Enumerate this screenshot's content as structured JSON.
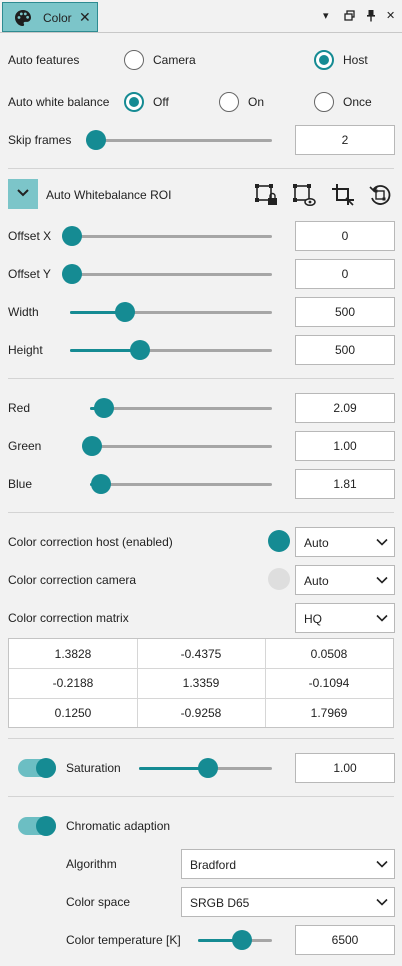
{
  "tab": {
    "title": "Color",
    "close": "✕",
    "icon": "palette-icon"
  },
  "window_controls": {
    "menu": "▾",
    "restore": "⧉",
    "pin": "📌",
    "close": "✕"
  },
  "auto_features": {
    "label": "Auto features",
    "options": [
      "Camera",
      "Host"
    ],
    "selected": "Host"
  },
  "auto_white_balance": {
    "label": "Auto white balance",
    "options": [
      "Off",
      "On",
      "Once"
    ],
    "selected": "Off"
  },
  "skip_frames": {
    "label": "Skip frames",
    "value": "2",
    "slider_fraction": 0.0
  },
  "roi": {
    "title": "Auto Whitebalance ROI",
    "icons": [
      "roi-lock-icon",
      "roi-view-icon",
      "roi-crop-icon",
      "roi-reset-icon"
    ],
    "offset_x": {
      "label": "Offset X",
      "value": "0",
      "slider_fraction": 0.0
    },
    "offset_y": {
      "label": "Offset Y",
      "value": "0",
      "slider_fraction": 0.0
    },
    "width": {
      "label": "Width",
      "value": "500",
      "slider_fraction": 0.27
    },
    "height": {
      "label": "Height",
      "value": "500",
      "slider_fraction": 0.34
    }
  },
  "gains": {
    "red": {
      "label": "Red",
      "value": "2.09",
      "slider_fraction": 0.07
    },
    "green": {
      "label": "Green",
      "value": "1.00",
      "slider_fraction": 0.0
    },
    "blue": {
      "label": "Blue",
      "value": "1.81",
      "slider_fraction": 0.05
    }
  },
  "color_correction": {
    "host": {
      "label": "Color correction host (enabled)",
      "value": "Auto",
      "status": "active"
    },
    "camera": {
      "label": "Color correction camera",
      "value": "Auto",
      "status": "inactive"
    },
    "matrix": {
      "label": "Color correction matrix",
      "value": "HQ"
    },
    "matrix_values": [
      [
        "1.3828",
        "-0.4375",
        "0.0508"
      ],
      [
        "-0.2188",
        "1.3359",
        "-0.1094"
      ],
      [
        "0.1250",
        "-0.9258",
        "1.7969"
      ]
    ]
  },
  "saturation": {
    "label": "Saturation",
    "value": "1.00",
    "enabled": true,
    "slider_fraction": 0.5
  },
  "chromatic": {
    "label": "Chromatic adaption",
    "enabled": true,
    "algorithm": {
      "label": "Algorithm",
      "value": "Bradford"
    },
    "color_space": {
      "label": "Color space",
      "value": "SRGB D65"
    },
    "temperature": {
      "label": "Color temperature [K]",
      "value": "6500",
      "slider_fraction": 0.6
    }
  },
  "colors": {
    "accent": "#158b93",
    "tab_bg": "#7cc5c9",
    "track": "#a6a6a6",
    "inactive_dot": "#dedede"
  }
}
